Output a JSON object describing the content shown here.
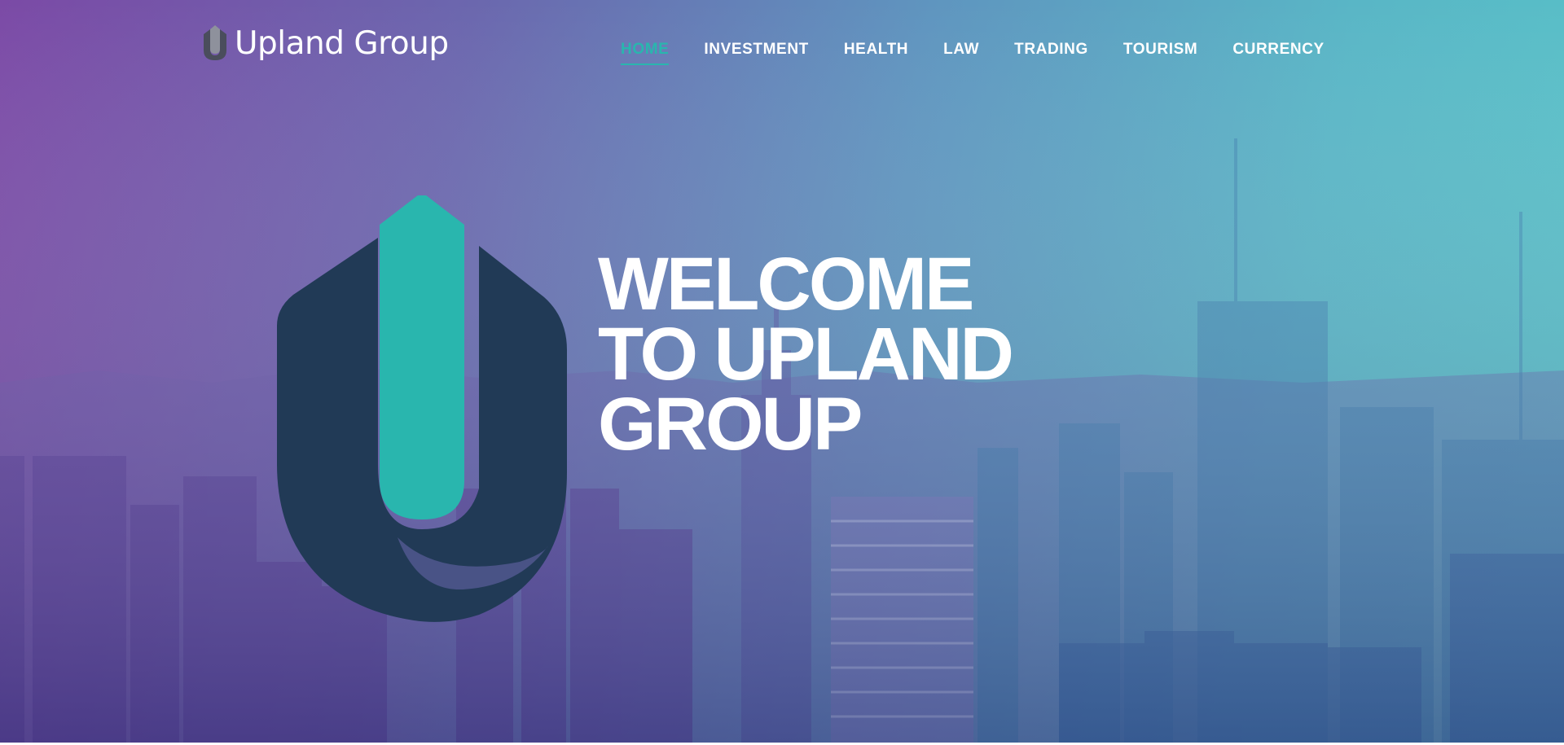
{
  "brand": {
    "name": "Upland Group",
    "logo_icon": "upland-u-logo-icon"
  },
  "nav": {
    "items": [
      {
        "label": "HOME",
        "active": true
      },
      {
        "label": "INVESTMENT",
        "active": false
      },
      {
        "label": "HEALTH",
        "active": false
      },
      {
        "label": "LAW",
        "active": false
      },
      {
        "label": "TRADING",
        "active": false
      },
      {
        "label": "TOURISM",
        "active": false
      },
      {
        "label": "CURRENCY",
        "active": false
      }
    ]
  },
  "hero": {
    "title_lines": [
      "WELCOME",
      "TO UPLAND",
      "GROUP"
    ],
    "background_image": "city-skyline-image"
  },
  "colors": {
    "accent": "#29b6ae",
    "logo_dark": "#213a56",
    "gradient_left": "#7b4aa6",
    "gradient_right": "#58c2c8",
    "text": "#ffffff"
  }
}
